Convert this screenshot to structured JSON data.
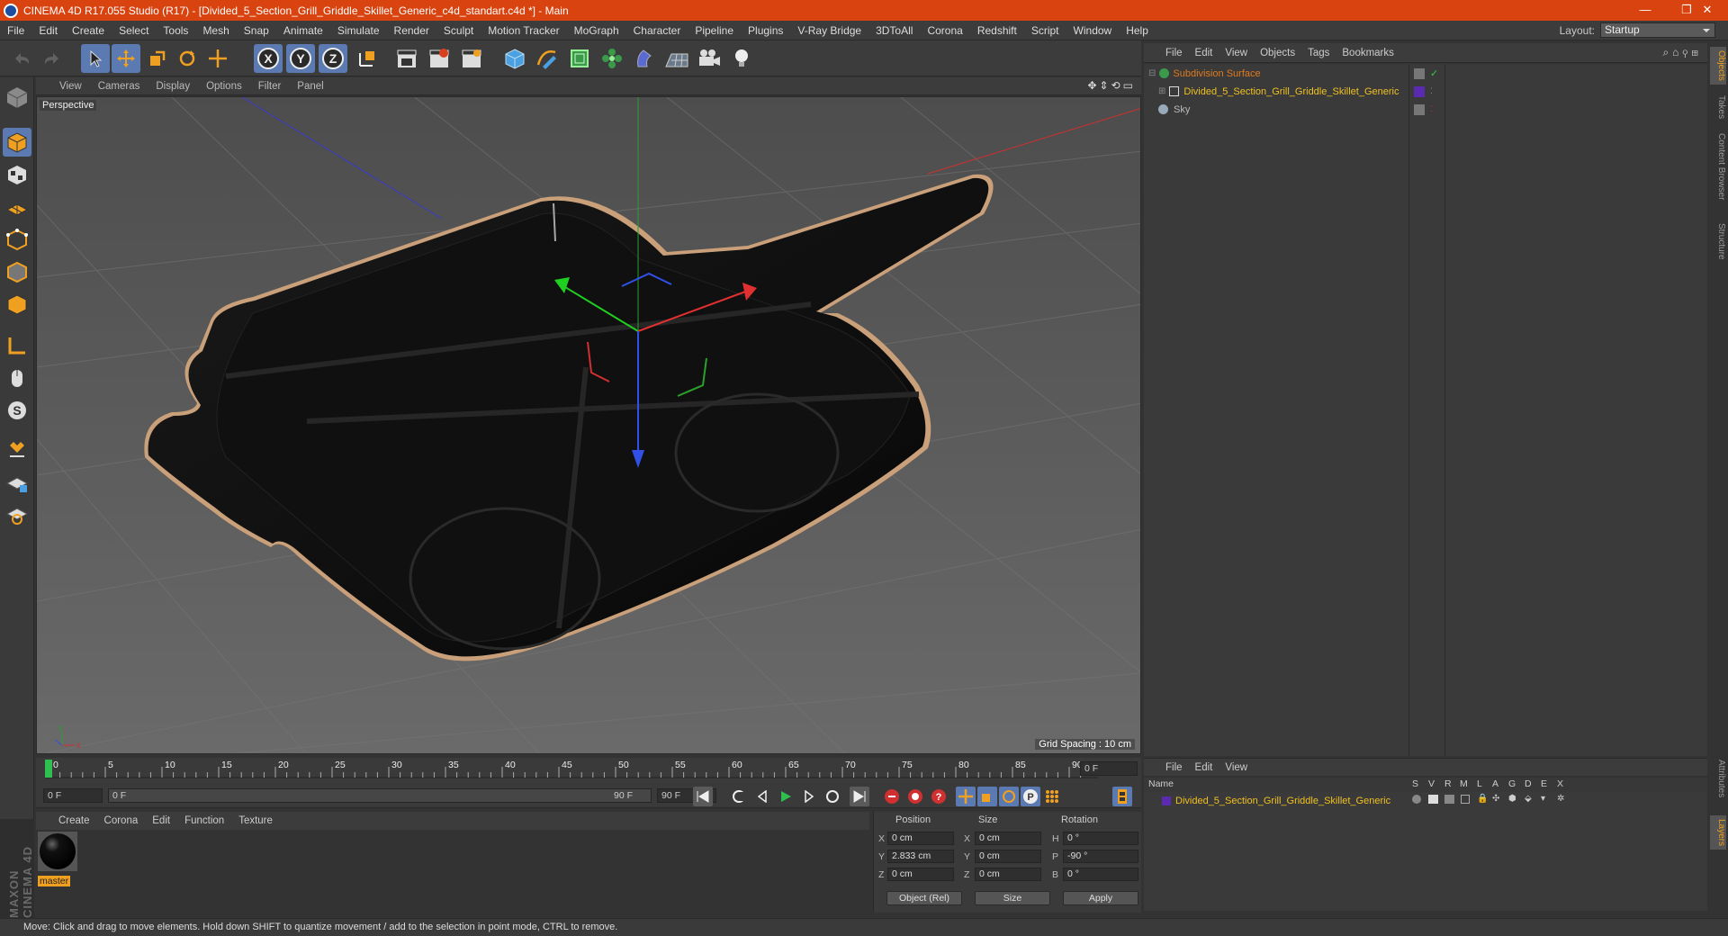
{
  "window": {
    "title": "CINEMA 4D R17.055 Studio (R17) - [Divided_5_Section_Grill_Griddle_Skillet_Generic_c4d_standart.c4d *] - Main",
    "minimize": "—",
    "restore": "❐",
    "close": "✕"
  },
  "menubar": {
    "items": [
      "File",
      "Edit",
      "Create",
      "Select",
      "Tools",
      "Mesh",
      "Snap",
      "Animate",
      "Simulate",
      "Render",
      "Sculpt",
      "Motion Tracker",
      "MoGraph",
      "Character",
      "Pipeline",
      "Plugins",
      "V-Ray Bridge",
      "3DToAll",
      "Corona",
      "Redshift",
      "Script",
      "Window",
      "Help"
    ],
    "layout_label": "Layout:",
    "layout_value": "Startup"
  },
  "toolbar": {
    "axes": [
      "X",
      "Y",
      "Z"
    ]
  },
  "viewport": {
    "menu": [
      "View",
      "Cameras",
      "Display",
      "Options",
      "Filter",
      "Panel"
    ],
    "label": "Perspective",
    "grid_spacing": "Grid Spacing : 10 cm"
  },
  "timeline": {
    "ticks": [
      "0",
      "5",
      "10",
      "15",
      "20",
      "25",
      "30",
      "35",
      "40",
      "45",
      "50",
      "55",
      "60",
      "65",
      "70",
      "75",
      "80",
      "85",
      "90"
    ],
    "current_frame": "0 F",
    "start": "0 F",
    "range_start": "0 F",
    "range_end": "90 F",
    "end": "90 F"
  },
  "materials": {
    "menu": [
      "Create",
      "Corona",
      "Edit",
      "Function",
      "Texture"
    ],
    "items": [
      {
        "name": "master"
      }
    ]
  },
  "coords": {
    "headers": [
      "Position",
      "Size",
      "Rotation"
    ],
    "rows": [
      {
        "axis": "X",
        "pos": "0 cm",
        "size_axis": "X",
        "size": "0 cm",
        "rot_axis": "H",
        "rot": "0 °"
      },
      {
        "axis": "Y",
        "pos": "2.833 cm",
        "size_axis": "Y",
        "size": "0 cm",
        "rot_axis": "P",
        "rot": "-90 °"
      },
      {
        "axis": "Z",
        "pos": "0 cm",
        "size_axis": "Z",
        "size": "0 cm",
        "rot_axis": "B",
        "rot": "0 °"
      }
    ],
    "mode": "Object (Rel)",
    "size_mode": "Size",
    "apply": "Apply"
  },
  "objects": {
    "menu": [
      "File",
      "Edit",
      "View",
      "Objects",
      "Tags",
      "Bookmarks"
    ],
    "items": [
      {
        "name": "Subdivision Surface",
        "color": "#e07a1e"
      },
      {
        "name": "Divided_5_Section_Grill_Griddle_Skillet_Generic",
        "color": "#f0c020"
      },
      {
        "name": "Sky",
        "color": "#bbbbbb"
      }
    ]
  },
  "layers": {
    "menu": [
      "File",
      "Edit",
      "View"
    ],
    "header": "Name",
    "cols": [
      "S",
      "V",
      "R",
      "M",
      "L",
      "A",
      "G",
      "D",
      "E",
      "X"
    ],
    "items": [
      {
        "name": "Divided_5_Section_Grill_Griddle_Skillet_Generic"
      }
    ]
  },
  "right_tabs": [
    "Objects",
    "Takes",
    "Content Browser",
    "Structure"
  ],
  "right_tabs_bottom": [
    "Attributes",
    "Layers"
  ],
  "brand": "MAXON CINEMA 4D",
  "status": "Move: Click and drag to move elements. Hold down SHIFT to quantize movement / add to the selection in point mode, CTRL to remove."
}
